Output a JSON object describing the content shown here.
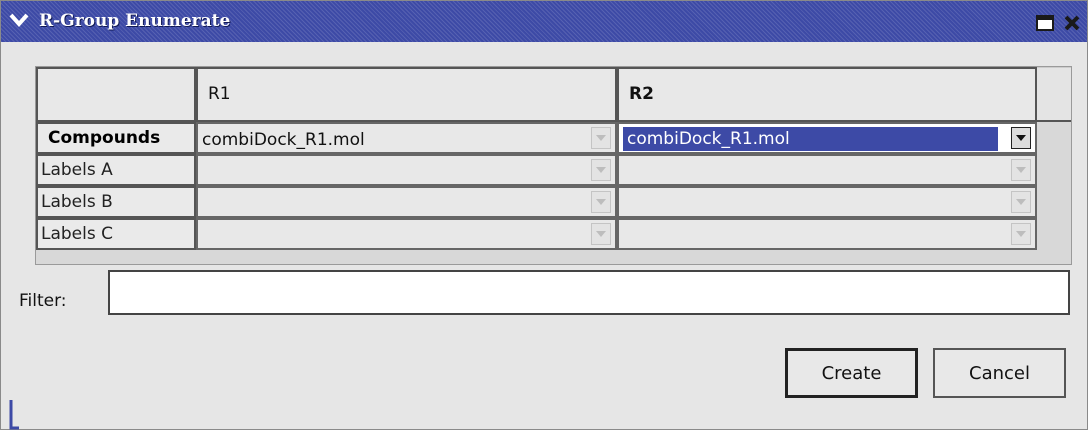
{
  "window": {
    "title": "R-Group Enumerate"
  },
  "table": {
    "columns": [
      {
        "label": "R1"
      },
      {
        "label": "R2"
      }
    ],
    "rows": [
      {
        "label": "Compounds",
        "r1_value": "combiDock_R1.mol",
        "r2_value": "combiDock_R1.mol"
      },
      {
        "label": "Labels A",
        "r1_value": "",
        "r2_value": ""
      },
      {
        "label": "Labels B",
        "r1_value": "",
        "r2_value": ""
      },
      {
        "label": "Labels C",
        "r1_value": "",
        "r2_value": ""
      }
    ]
  },
  "filter": {
    "label": "Filter:",
    "value": ""
  },
  "buttons": {
    "create": "Create",
    "cancel": "Cancel"
  },
  "icons": {
    "window_menu": "chevron-down-icon",
    "maximize": "maximize-icon",
    "close": "close-icon",
    "dropdown": "dropdown-arrow-icon"
  },
  "colors": {
    "title_bar": "#3d4aa6",
    "selection": "#3d4aa6",
    "background": "#e6e6e6"
  }
}
